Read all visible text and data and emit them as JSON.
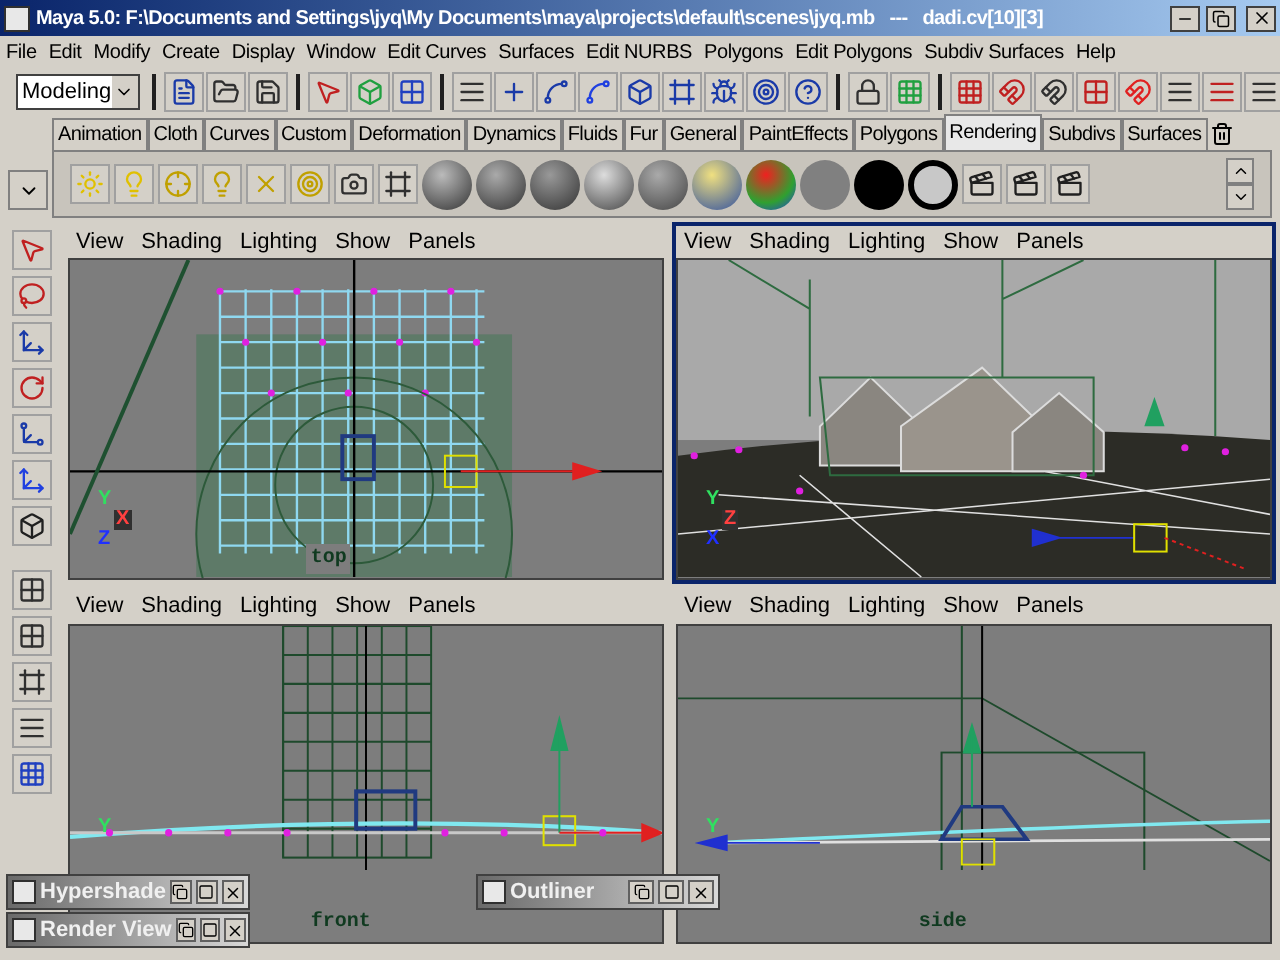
{
  "window": {
    "title": "Maya 5.0: F:\\Documents and Settings\\jyq\\My Documents\\maya\\projects\\default\\scenes\\jyq.mb   ---   dadi.cv[10][3]"
  },
  "menu_bar": [
    "File",
    "Edit",
    "Modify",
    "Create",
    "Display",
    "Window",
    "Edit Curves",
    "Surfaces",
    "Edit NURBS",
    "Polygons",
    "Edit Polygons",
    "Subdiv Surfaces",
    "Help"
  ],
  "status_line": {
    "menu_set": "Modeling"
  },
  "shelf_tabs": [
    {
      "label": "Animation",
      "selected": false
    },
    {
      "label": "Cloth",
      "selected": false
    },
    {
      "label": "Curves",
      "selected": false
    },
    {
      "label": "Custom",
      "selected": false
    },
    {
      "label": "Deformation",
      "selected": false
    },
    {
      "label": "Dynamics",
      "selected": false
    },
    {
      "label": "Fluids",
      "selected": false
    },
    {
      "label": "Fur",
      "selected": false
    },
    {
      "label": "General",
      "selected": false
    },
    {
      "label": "PaintEffects",
      "selected": false
    },
    {
      "label": "Polygons",
      "selected": false
    },
    {
      "label": "Rendering",
      "selected": true
    },
    {
      "label": "Subdivs",
      "selected": false
    },
    {
      "label": "Surfaces",
      "selected": false
    }
  ],
  "viewports": [
    {
      "kind": "top",
      "label": "top",
      "selected": false,
      "menu": [
        "View",
        "Shading",
        "Lighting",
        "Show",
        "Panels"
      ],
      "axis_labels": [
        "Y",
        "X",
        "Z"
      ]
    },
    {
      "kind": "persp",
      "selected": true,
      "menu": [
        "View",
        "Shading",
        "Lighting",
        "Show",
        "Panels"
      ],
      "axis_labels": [
        "Y",
        "Z",
        "X"
      ]
    },
    {
      "kind": "front",
      "label": "front",
      "selected": false,
      "menu": [
        "View",
        "Shading",
        "Lighting",
        "Show",
        "Panels"
      ],
      "axis_labels": [
        "Y"
      ]
    },
    {
      "kind": "side",
      "label": "side",
      "selected": false,
      "menu": [
        "View",
        "Shading",
        "Lighting",
        "Show",
        "Panels"
      ],
      "axis_labels": [
        "Y"
      ]
    }
  ],
  "floating_windows": [
    {
      "title": "Hypershade"
    },
    {
      "title": "Render View"
    },
    {
      "title": "Outliner"
    }
  ]
}
